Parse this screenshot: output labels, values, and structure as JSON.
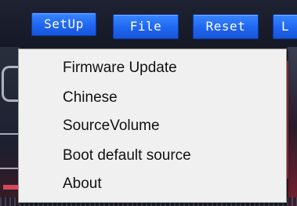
{
  "toolbar": {
    "setup_label": "SetUp",
    "file_label": "File",
    "reset_label": "Reset",
    "partial_label": "L"
  },
  "setup_menu": {
    "items": [
      {
        "label": "Firmware Update"
      },
      {
        "label": "Chinese"
      },
      {
        "label": "SourceVolume"
      },
      {
        "label": "Boot default source"
      },
      {
        "label": "About"
      }
    ]
  },
  "colors": {
    "button_blue": "#1f66f0",
    "menu_background": "#f0f0f0",
    "app_background": "#1a1e2b",
    "accent_red": "#c83848"
  }
}
